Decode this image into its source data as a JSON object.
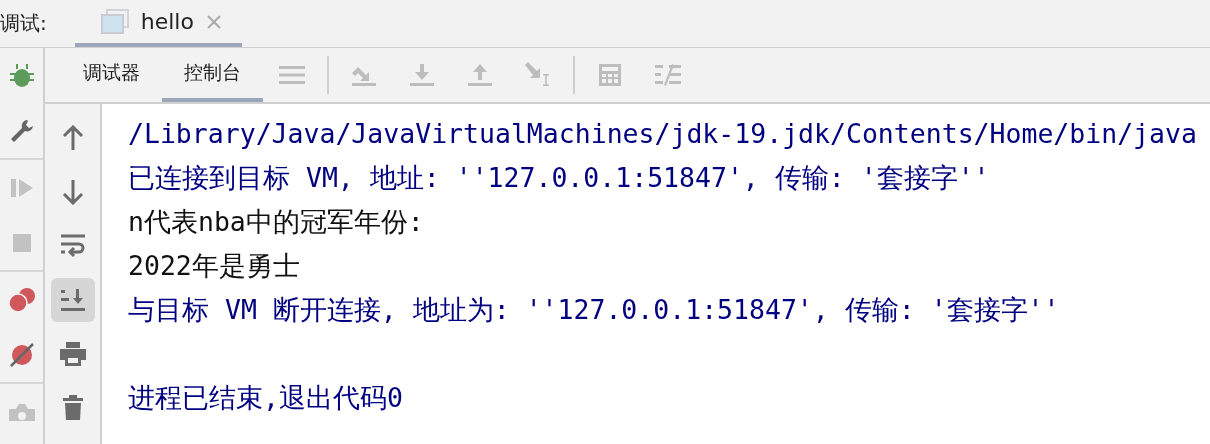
{
  "debug_bar": {
    "label": "调试:",
    "tabs": [
      {
        "label": "hello",
        "selected": true
      }
    ]
  },
  "left_toolbar": [
    {
      "kind": "bug",
      "disabled": false
    },
    {
      "kind": "wrench",
      "disabled": false
    },
    {
      "kind": "resume",
      "disabled": true
    },
    {
      "kind": "stop",
      "disabled": true
    },
    {
      "kind": "breakpoints",
      "disabled": false
    },
    {
      "kind": "mute",
      "disabled": false
    },
    {
      "kind": "camera",
      "disabled": true
    }
  ],
  "panel_tabs": [
    {
      "label": "调试器",
      "selected": false
    },
    {
      "label": "控制台",
      "selected": true
    }
  ],
  "toolbar": [
    {
      "kind": "menu",
      "disabled": true
    },
    {
      "kind": "step-over",
      "disabled": true
    },
    {
      "kind": "step-into",
      "disabled": true
    },
    {
      "kind": "step-out",
      "disabled": true
    },
    {
      "kind": "run-to-cursor",
      "disabled": true
    },
    {
      "kind": "calculator",
      "disabled": true
    },
    {
      "kind": "trace",
      "disabled": true
    }
  ],
  "console_toolbar": [
    {
      "kind": "up",
      "selected": false
    },
    {
      "kind": "down",
      "selected": false
    },
    {
      "kind": "wrap",
      "selected": false
    },
    {
      "kind": "scroll-end",
      "selected": true
    },
    {
      "kind": "print",
      "selected": false
    },
    {
      "kind": "trash",
      "selected": false
    }
  ],
  "console": [
    {
      "text": "/Library/Java/JavaVirtualMachines/jdk-19.jdk/Contents/Home/bin/java",
      "kind": "system",
      "gap_before": false
    },
    {
      "text": "已连接到目标 VM, 地址: ''127.0.0.1:51847', 传输: '套接字''",
      "kind": "system",
      "gap_before": false
    },
    {
      "text": "n代表nba中的冠军年份:",
      "kind": "output",
      "gap_before": false
    },
    {
      "text": "2022年是勇士",
      "kind": "output",
      "gap_before": false
    },
    {
      "text": "与目标 VM 断开连接, 地址为: ''127.0.0.1:51847', 传输: '套接字''",
      "kind": "system",
      "gap_before": false
    },
    {
      "text": "进程已结束,退出代码0",
      "kind": "system",
      "gap_before": true
    }
  ]
}
